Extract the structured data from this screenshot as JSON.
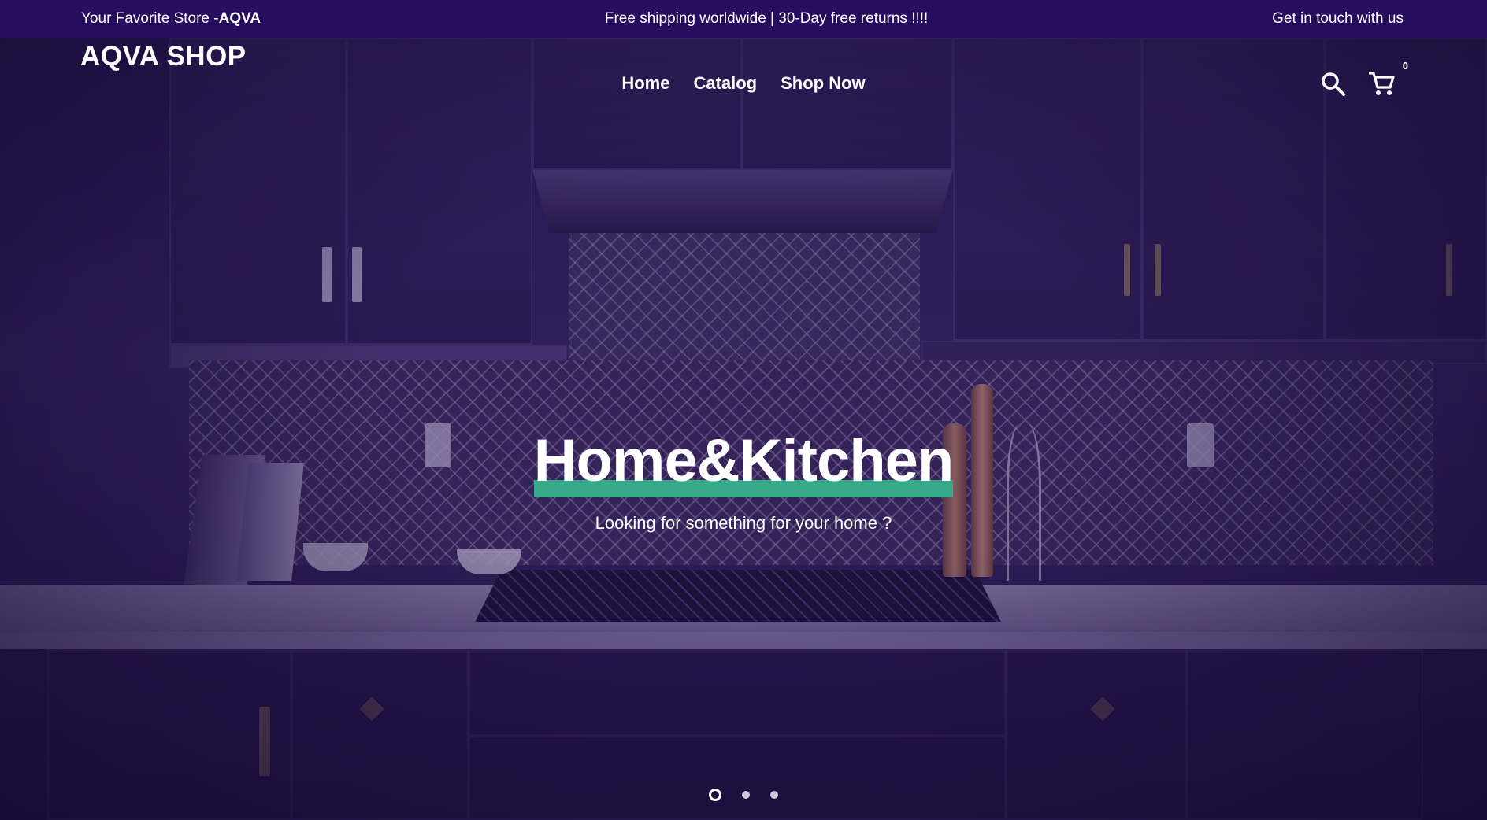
{
  "announcement": {
    "store_prefix": "Your Favorite Store -",
    "store_name": "AQVA",
    "shipping": "Free shipping worldwide | 30-Day free returns !!!!",
    "contact": "Get in touch with us"
  },
  "header": {
    "logo": "AQVA SHOP",
    "nav": [
      {
        "label": "Home"
      },
      {
        "label": "Catalog"
      },
      {
        "label": "Shop Now"
      }
    ],
    "cart_count": "0",
    "icons": [
      "search-icon",
      "cart-icon"
    ]
  },
  "hero": {
    "title": "Home&Kitchen",
    "subtitle": "Looking for something for your home ?",
    "slides_total": 3,
    "active_slide": 1
  },
  "colors": {
    "announcement_bg": "#260d5e",
    "overlay": "#220e4e",
    "accent_underline": "#38a98b"
  }
}
